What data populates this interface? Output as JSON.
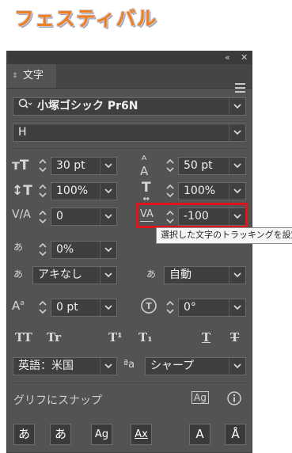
{
  "banner": {
    "title": "フェスティバル",
    "color": "#f07e1c"
  },
  "panel": {
    "title_bar": {
      "collapse_glyph": "«",
      "close_glyph": "✕"
    },
    "tab": {
      "label": "文字"
    },
    "font_family": {
      "value": "小塚ゴシック Pr6N"
    },
    "font_style": {
      "value": "H"
    },
    "font_size": {
      "value": "30 pt"
    },
    "leading": {
      "value": "50 pt"
    },
    "vertical_scale": {
      "value": "100%"
    },
    "horizontal_scale": {
      "value": "100%"
    },
    "kerning": {
      "value": "0"
    },
    "tracking": {
      "value": "-100"
    },
    "tsume": {
      "value": "0%"
    },
    "aki_left": {
      "value": "アキなし"
    },
    "aki_right": {
      "value": "自動"
    },
    "baseline_shift": {
      "value": "0 pt"
    },
    "rotation": {
      "value": "0°"
    },
    "text_buttons": {
      "all_caps": "TT",
      "small_caps": "Tr",
      "superscript": "T¹",
      "subscript": "T₁",
      "underline": "T",
      "strikethrough": "T"
    },
    "language": {
      "value": "英語：米国"
    },
    "antialias_icon_label": "ªa",
    "antialias": {
      "value": "シャープ"
    },
    "snap_to_glyph": {
      "label": "グリフにスナップ"
    },
    "bottom_icons": [
      "あ",
      "あ",
      "Ag",
      "Ax",
      "A",
      "Å"
    ]
  },
  "tooltip": {
    "text": "選択した文字のトラッキングを設定"
  },
  "highlight_color": "#e1131b"
}
